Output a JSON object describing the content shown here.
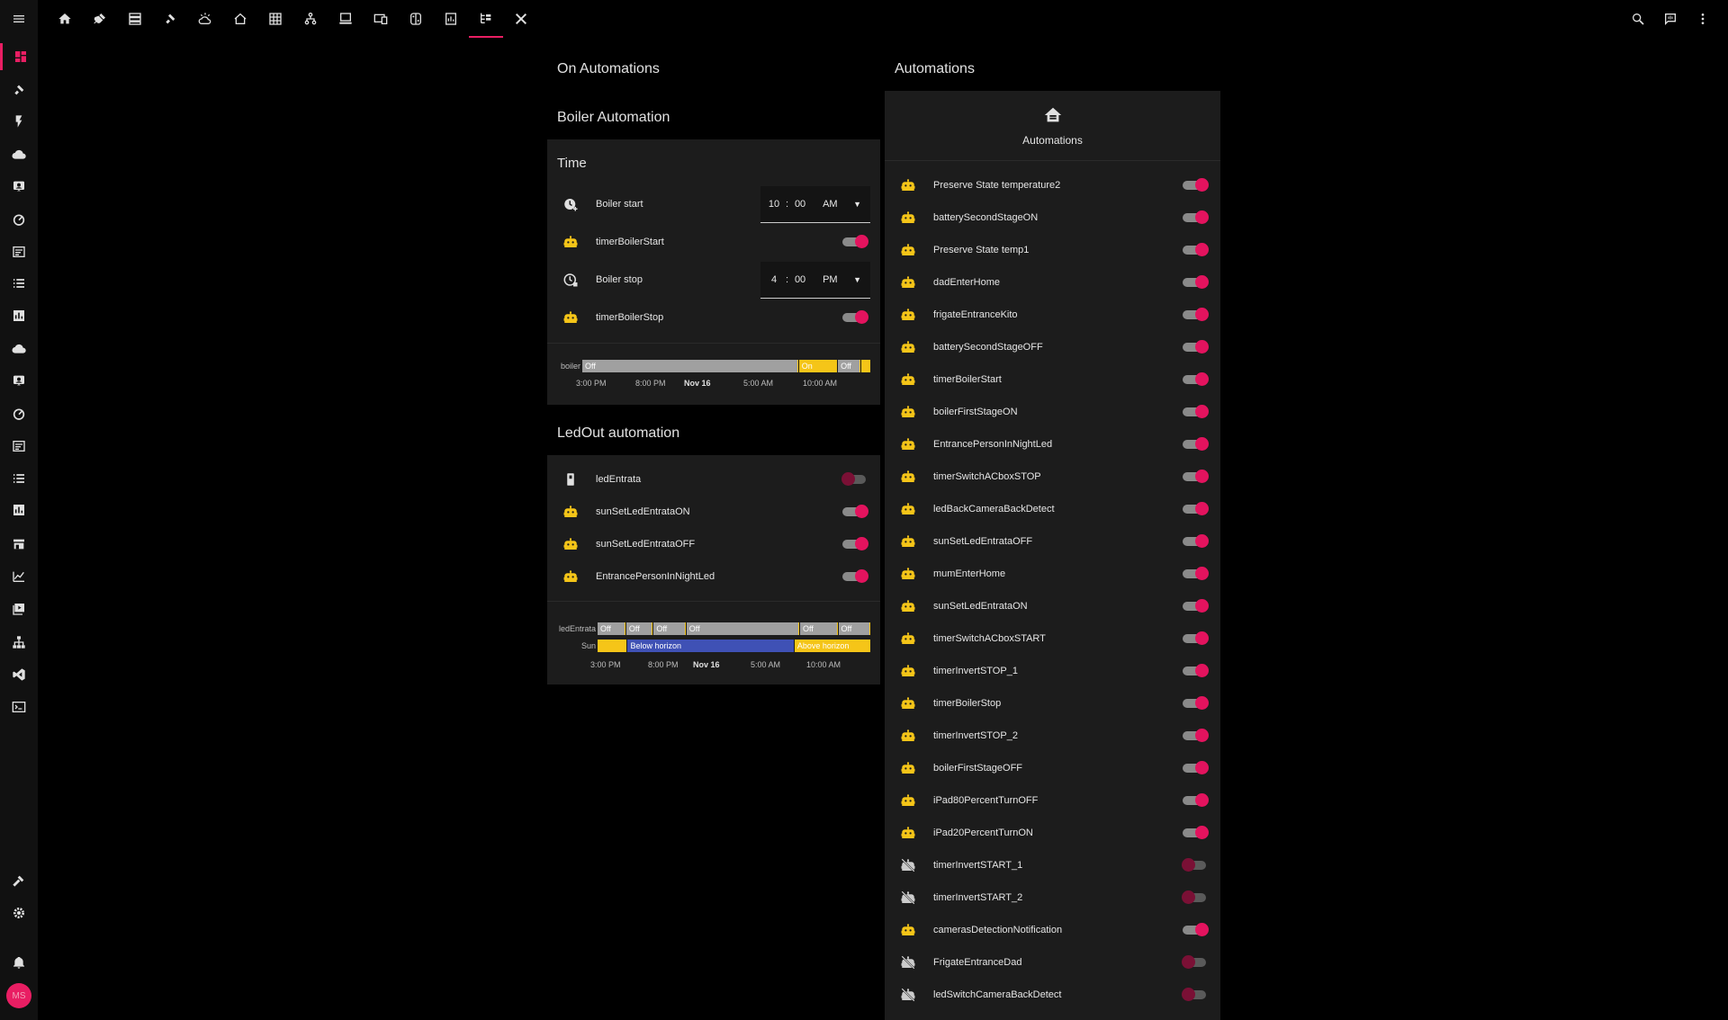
{
  "colors": {
    "accent": "#e91e63",
    "automation_icon": "#f5c518",
    "tl_off": "#a0a0a0",
    "tl_on": "#f5c518",
    "tl_below": "#3f51b5"
  },
  "sidebar": {
    "items": [
      "dashboard-icon",
      "satellite-icon",
      "flash-icon",
      "cloud-icon",
      "badge-icon",
      "gauge-icon",
      "history-icon",
      "list-icon",
      "chart-icon",
      "cloud-icon",
      "badge-icon",
      "gauge-icon",
      "history-icon",
      "list-icon",
      "chart-icon",
      "store-icon",
      "trend-icon",
      "media-icon",
      "network-icon",
      "code-icon",
      "terminal-icon"
    ],
    "tools": [
      "hammer-icon",
      "settings-icon",
      "bell-icon"
    ],
    "avatar": "MS"
  },
  "topbar": {
    "tabs": [
      "home-icon",
      "plug-icon",
      "server-icon",
      "satellite-icon",
      "weather-icon",
      "house-icon",
      "grid-icon",
      "hierarchy-icon",
      "monitor-icon",
      "devices-icon",
      "nintendo-icon",
      "file-icon",
      "tree-icon",
      "tools-icon"
    ],
    "active_tab": 12
  },
  "left": {
    "title": "On Automations",
    "boiler": {
      "title": "Boiler Automation",
      "section": "Time",
      "rows": [
        {
          "name": "Boiler start",
          "kind": "time",
          "icon": "clock-plus-icon",
          "h": "10",
          "m": "00",
          "ampm": "AM"
        },
        {
          "name": "timerBoilerStart",
          "kind": "toggle",
          "icon": "robot-icon",
          "on": true
        },
        {
          "name": "Boiler stop",
          "kind": "time",
          "icon": "clock-stop-icon",
          "h": "4",
          "m": "00",
          "ampm": "PM"
        },
        {
          "name": "timerBoilerStop",
          "kind": "toggle",
          "icon": "robot-icon",
          "on": true
        }
      ],
      "timeline": {
        "entity": "boiler",
        "segments": [
          {
            "label": "Off",
            "state": "off",
            "start": 0,
            "end": 0.75
          },
          {
            "label": "On",
            "state": "on",
            "start": 0.75,
            "end": 0.885
          },
          {
            "label": "Off",
            "state": "off",
            "start": 0.885,
            "end": 0.965
          },
          {
            "label": "",
            "state": "on",
            "start": 0.965,
            "end": 1
          }
        ],
        "ticks": [
          "3:00 PM",
          "8:00 PM",
          "Nov 16",
          "5:00 AM",
          "10:00 AM"
        ]
      }
    },
    "ledout": {
      "title": "LedOut automation",
      "rows": [
        {
          "name": "ledEntrata",
          "icon": "switch-icon",
          "on": false
        },
        {
          "name": "sunSetLedEntrataON",
          "icon": "robot-icon",
          "on": true
        },
        {
          "name": "sunSetLedEntrataOFF",
          "icon": "robot-icon",
          "on": true
        },
        {
          "name": "EntrancePersonInNightLed",
          "icon": "robot-icon",
          "on": true
        }
      ],
      "timeline": {
        "rows": [
          {
            "entity": "ledEntrata",
            "segments": [
              {
                "label": "Off",
                "state": "off",
                "start": 0,
                "end": 0.105
              },
              {
                "label": "Off",
                "state": "off",
                "start": 0.105,
                "end": 0.205
              },
              {
                "label": "Off",
                "state": "off",
                "start": 0.205,
                "end": 0.325
              },
              {
                "label": "Off",
                "state": "off",
                "start": 0.325,
                "end": 0.74
              },
              {
                "label": "Off",
                "state": "off",
                "start": 0.74,
                "end": 0.88
              },
              {
                "label": "Off",
                "state": "off",
                "start": 0.88,
                "end": 1
              }
            ]
          },
          {
            "entity": "Sun",
            "segments": [
              {
                "label": "",
                "state": "on",
                "start": 0,
                "end": 0.11
              },
              {
                "label": "Below horizon",
                "state": "below",
                "start": 0.11,
                "end": 0.72
              },
              {
                "label": "Above horizon",
                "state": "on",
                "start": 0.72,
                "end": 1
              }
            ]
          }
        ],
        "ticks": [
          "3:00 PM",
          "8:00 PM",
          "Nov 16",
          "5:00 AM",
          "10:00 AM"
        ]
      }
    }
  },
  "right": {
    "title": "Automations",
    "header_label": "Automations",
    "items": [
      {
        "name": "Preserve State temperature2",
        "on": true
      },
      {
        "name": "batterySecondStageON",
        "on": true
      },
      {
        "name": "Preserve State temp1",
        "on": true
      },
      {
        "name": "dadEnterHome",
        "on": true
      },
      {
        "name": "frigateEntranceKito",
        "on": true
      },
      {
        "name": "batterySecondStageOFF",
        "on": true
      },
      {
        "name": "timerBoilerStart",
        "on": true
      },
      {
        "name": "boilerFirstStageON",
        "on": true
      },
      {
        "name": "EntrancePersonInNightLed",
        "on": true
      },
      {
        "name": "timerSwitchACboxSTOP",
        "on": true
      },
      {
        "name": "ledBackCameraBackDetect",
        "on": true
      },
      {
        "name": "sunSetLedEntrataOFF",
        "on": true
      },
      {
        "name": "mumEnterHome",
        "on": true
      },
      {
        "name": "sunSetLedEntrataON",
        "on": true
      },
      {
        "name": "timerSwitchACboxSTART",
        "on": true
      },
      {
        "name": "timerInvertSTOP_1",
        "on": true
      },
      {
        "name": "timerBoilerStop",
        "on": true
      },
      {
        "name": "timerInvertSTOP_2",
        "on": true
      },
      {
        "name": "boilerFirstStageOFF",
        "on": true
      },
      {
        "name": "iPad80PercentTurnOFF",
        "on": true
      },
      {
        "name": "iPad20PercentTurnON",
        "on": true
      },
      {
        "name": "timerInvertSTART_1",
        "on": false
      },
      {
        "name": "timerInvertSTART_2",
        "on": false
      },
      {
        "name": "camerasDetectionNotification",
        "on": true
      },
      {
        "name": "FrigateEntranceDad",
        "on": false
      },
      {
        "name": "ledSwitchCameraBackDetect",
        "on": false
      }
    ]
  }
}
